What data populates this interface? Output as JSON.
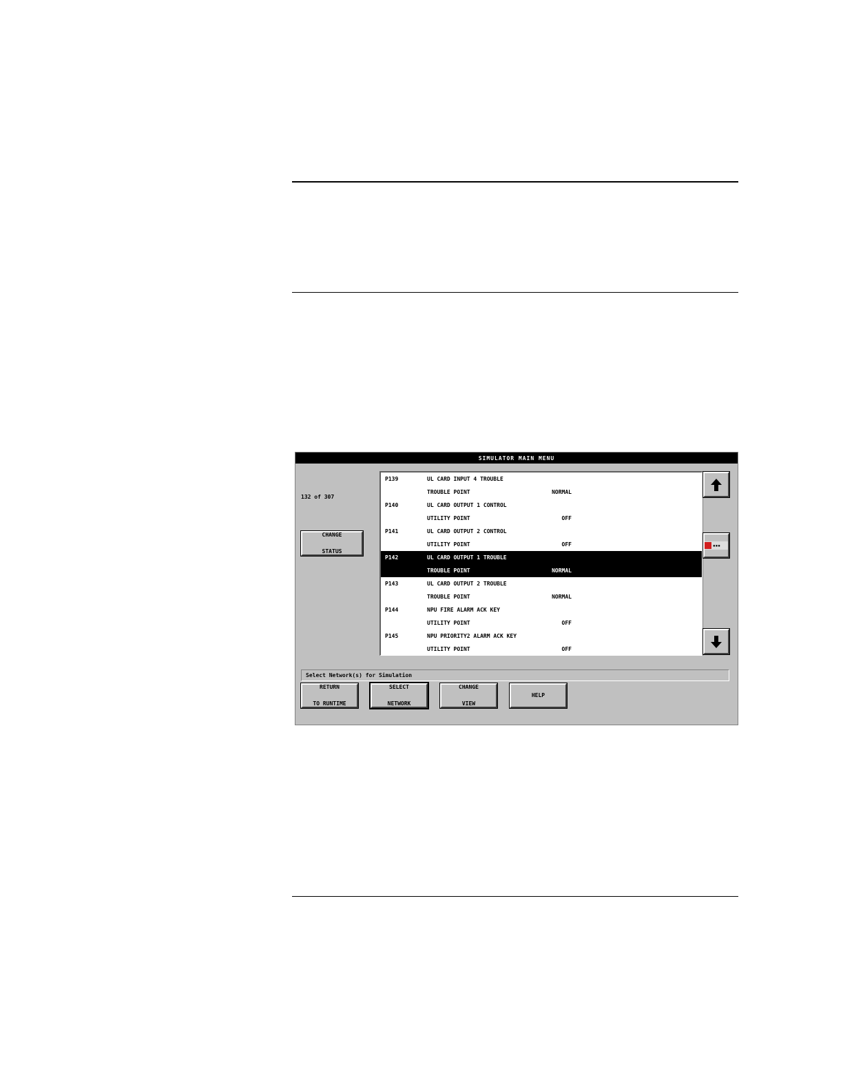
{
  "window": {
    "title": "SIMULATOR MAIN MENU"
  },
  "counter": "132 of 307",
  "change_status": {
    "line1": "CHANGE",
    "line2": "STATUS"
  },
  "points": [
    {
      "id": "P139",
      "name": "UL CARD INPUT 4 TROUBLE",
      "type": "TROUBLE POINT",
      "state": "NORMAL"
    },
    {
      "id": "P140",
      "name": "UL CARD OUTPUT 1 CONTROL",
      "type": "UTILITY POINT",
      "state": "OFF"
    },
    {
      "id": "P141",
      "name": "UL CARD OUTPUT 2 CONTROL",
      "type": "UTILITY POINT",
      "state": "OFF"
    },
    {
      "id": "P142",
      "name": "UL CARD OUTPUT 1 TROUBLE",
      "type": "TROUBLE POINT",
      "state": "NORMAL",
      "selected": true
    },
    {
      "id": "P143",
      "name": "UL CARD OUTPUT 2 TROUBLE",
      "type": "TROUBLE POINT",
      "state": "NORMAL"
    },
    {
      "id": "P144",
      "name": "NPU FIRE ALARM ACK KEY",
      "type": "UTILITY POINT",
      "state": "OFF"
    },
    {
      "id": "P145",
      "name": "NPU PRIORITY2 ALARM ACK KEY",
      "type": "UTILITY POINT",
      "state": "OFF"
    }
  ],
  "scrollbar": {
    "up_icon": "arrow-up-icon",
    "down_icon": "arrow-down-icon",
    "logo_icon": "simplex-logo-icon"
  },
  "status_message": "Select Network(s) for Simulation",
  "buttons": {
    "return": {
      "line1": "RETURN",
      "line2": "TO RUNTIME"
    },
    "select_network": {
      "line1": "SELECT",
      "line2": "NETWORK"
    },
    "change_view": {
      "line1": "CHANGE",
      "line2": "VIEW"
    },
    "help": {
      "label": "HELP"
    }
  }
}
